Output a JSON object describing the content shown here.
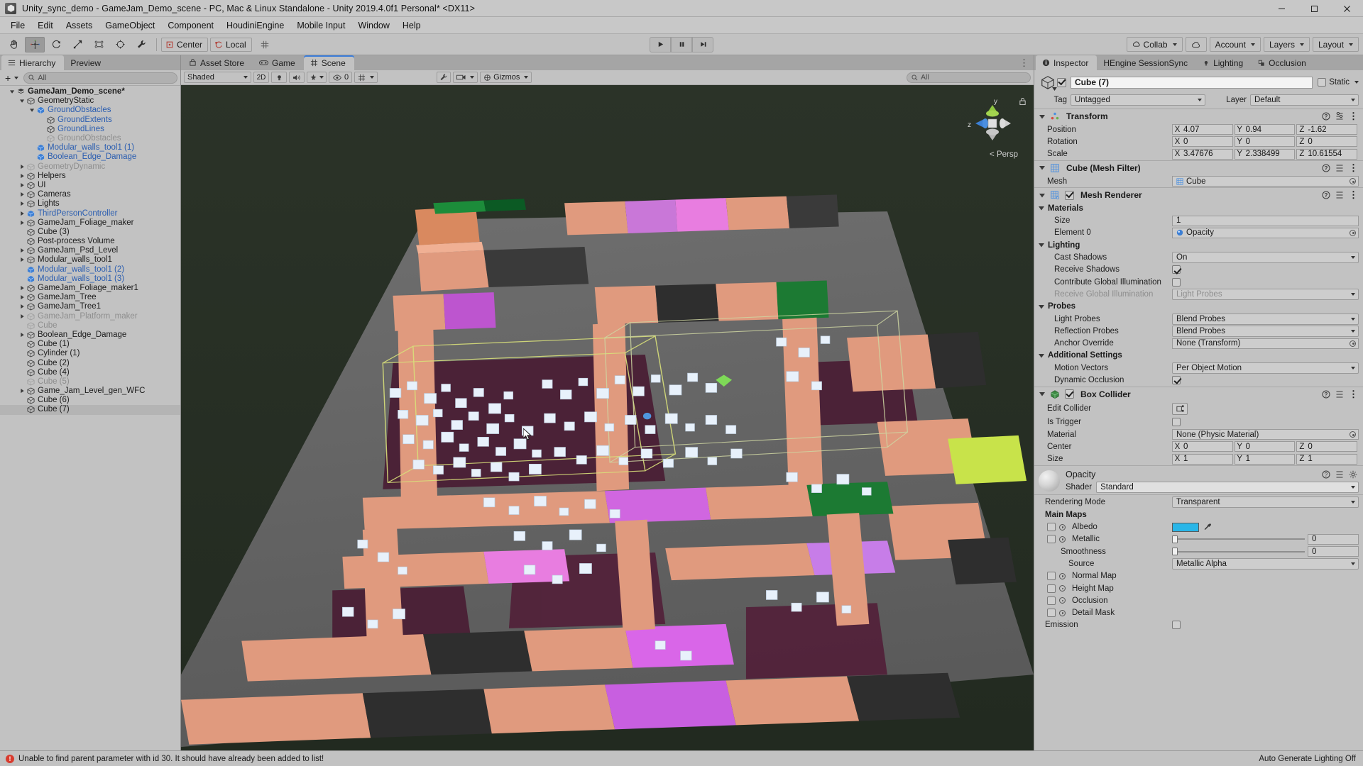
{
  "window": {
    "title": "Unity_sync_demo - GameJam_Demo_scene - PC, Mac & Linux Standalone - Unity 2019.4.0f1 Personal* <DX11>",
    "minimize": "—",
    "maximize": "❐",
    "close": "✕"
  },
  "menubar": {
    "items": [
      "File",
      "Edit",
      "Assets",
      "GameObject",
      "Component",
      "HoudiniEngine",
      "Mobile Input",
      "Window",
      "Help"
    ]
  },
  "toolbar": {
    "tools": [
      "hand-tool",
      "move-tool",
      "rotate-tool",
      "scale-tool",
      "rect-tool",
      "transform-tool",
      "custom-tool"
    ],
    "pivot_mode": "Center",
    "pivot_rotation": "Local",
    "grid_snap": "grid-snap-icon",
    "play": "play-button",
    "pause": "pause-button",
    "step": "step-button",
    "collab": "Collab",
    "cloud": "cloud-icon",
    "account": "Account",
    "layers": "Layers",
    "layout": "Layout"
  },
  "hierarchy": {
    "tabs": [
      {
        "label": "Hierarchy",
        "icon": "hierarchy-icon",
        "active": true
      },
      {
        "label": "Preview",
        "icon": "",
        "active": false
      }
    ],
    "create_label": "+",
    "search_placeholder": "All",
    "items": [
      {
        "label": "GameJam_Demo_scene*",
        "depth": 0,
        "tri": "down",
        "icon": "scene",
        "style": "bold",
        "selected": false
      },
      {
        "label": "GeometryStatic",
        "depth": 1,
        "tri": "down",
        "icon": "go",
        "style": "normal",
        "selected": false
      },
      {
        "label": "GroundObstacles",
        "depth": 2,
        "tri": "down",
        "icon": "prefab",
        "style": "prefab",
        "selected": false
      },
      {
        "label": "GroundExtents",
        "depth": 3,
        "tri": "none",
        "icon": "go",
        "style": "prefab",
        "selected": false
      },
      {
        "label": "GroundLines",
        "depth": 3,
        "tri": "none",
        "icon": "go",
        "style": "prefab",
        "selected": false
      },
      {
        "label": "GroundObstacles",
        "depth": 3,
        "tri": "none",
        "icon": "go-dim",
        "style": "dim",
        "selected": false
      },
      {
        "label": "Modular_walls_tool1 (1)",
        "depth": 2,
        "tri": "none",
        "icon": "prefab",
        "style": "prefab",
        "selected": false
      },
      {
        "label": "Boolean_Edge_Damage",
        "depth": 2,
        "tri": "none",
        "icon": "prefab",
        "style": "prefab",
        "selected": false
      },
      {
        "label": "GeometryDynamic",
        "depth": 1,
        "tri": "right",
        "icon": "go-dim",
        "style": "dim",
        "selected": false
      },
      {
        "label": "Helpers",
        "depth": 1,
        "tri": "right",
        "icon": "go",
        "style": "normal",
        "selected": false
      },
      {
        "label": "UI",
        "depth": 1,
        "tri": "right",
        "icon": "go",
        "style": "normal",
        "selected": false
      },
      {
        "label": "Cameras",
        "depth": 1,
        "tri": "right",
        "icon": "go",
        "style": "normal",
        "selected": false
      },
      {
        "label": "Lights",
        "depth": 1,
        "tri": "right",
        "icon": "go",
        "style": "normal",
        "selected": false
      },
      {
        "label": "ThirdPersonController",
        "depth": 1,
        "tri": "right",
        "icon": "prefab",
        "style": "prefab",
        "selected": false
      },
      {
        "label": "GameJam_Foliage_maker",
        "depth": 1,
        "tri": "right",
        "icon": "go",
        "style": "normal",
        "selected": false
      },
      {
        "label": "Cube (3)",
        "depth": 1,
        "tri": "none",
        "icon": "go",
        "style": "normal",
        "selected": false
      },
      {
        "label": "Post-process Volume",
        "depth": 1,
        "tri": "none",
        "icon": "go",
        "style": "normal",
        "selected": false
      },
      {
        "label": "GameJam_Psd_Level",
        "depth": 1,
        "tri": "right",
        "icon": "go",
        "style": "normal",
        "selected": false
      },
      {
        "label": "Modular_walls_tool1",
        "depth": 1,
        "tri": "right",
        "icon": "go",
        "style": "normal",
        "selected": false
      },
      {
        "label": "Modular_walls_tool1 (2)",
        "depth": 1,
        "tri": "none",
        "icon": "prefab",
        "style": "prefab",
        "selected": false
      },
      {
        "label": "Modular_walls_tool1 (3)",
        "depth": 1,
        "tri": "none",
        "icon": "prefab",
        "style": "prefab",
        "selected": false
      },
      {
        "label": "GameJam_Foliage_maker1",
        "depth": 1,
        "tri": "right",
        "icon": "go",
        "style": "normal",
        "selected": false
      },
      {
        "label": "GameJam_Tree",
        "depth": 1,
        "tri": "right",
        "icon": "go",
        "style": "normal",
        "selected": false
      },
      {
        "label": "GameJam_Tree1",
        "depth": 1,
        "tri": "right",
        "icon": "go",
        "style": "normal",
        "selected": false
      },
      {
        "label": "GameJam_Platform_maker",
        "depth": 1,
        "tri": "right",
        "icon": "go-dim",
        "style": "dim",
        "selected": false
      },
      {
        "label": "Cube",
        "depth": 1,
        "tri": "none",
        "icon": "go-dim",
        "style": "dim",
        "selected": false
      },
      {
        "label": "Boolean_Edge_Damage",
        "depth": 1,
        "tri": "right",
        "icon": "go",
        "style": "normal",
        "selected": false
      },
      {
        "label": "Cube (1)",
        "depth": 1,
        "tri": "none",
        "icon": "go",
        "style": "normal",
        "selected": false
      },
      {
        "label": "Cylinder (1)",
        "depth": 1,
        "tri": "none",
        "icon": "go",
        "style": "normal",
        "selected": false
      },
      {
        "label": "Cube (2)",
        "depth": 1,
        "tri": "none",
        "icon": "go",
        "style": "normal",
        "selected": false
      },
      {
        "label": "Cube (4)",
        "depth": 1,
        "tri": "none",
        "icon": "go",
        "style": "normal",
        "selected": false
      },
      {
        "label": "Cube (5)",
        "depth": 1,
        "tri": "none",
        "icon": "go-dim",
        "style": "dim",
        "selected": false
      },
      {
        "label": "Game_Jam_Level_gen_WFC",
        "depth": 1,
        "tri": "right",
        "icon": "go",
        "style": "normal",
        "selected": false
      },
      {
        "label": "Cube (6)",
        "depth": 1,
        "tri": "none",
        "icon": "go",
        "style": "normal",
        "selected": false
      },
      {
        "label": "Cube (7)",
        "depth": 1,
        "tri": "none",
        "icon": "go",
        "style": "normal",
        "selected": true
      }
    ]
  },
  "scene": {
    "tabs": [
      {
        "label": "Asset Store",
        "icon": "store-icon",
        "active": false
      },
      {
        "label": "Game",
        "icon": "game-icon",
        "active": false
      },
      {
        "label": "Scene",
        "icon": "scene-icon",
        "active": true
      }
    ],
    "draw_mode": "Shaded",
    "mode_2d": "2D",
    "lighting_toggle": "lighting-icon",
    "audio_toggle": "audio-icon",
    "fx_toggle": "fx-icon",
    "hidden_count": "0",
    "scene_vis": "scene-vis-icon",
    "gizmos": "Gizmos",
    "search_placeholder": "All",
    "gizmo_axes": {
      "y": "y",
      "z": "z"
    },
    "projection": "Persp"
  },
  "inspector": {
    "tabs": [
      {
        "label": "Inspector",
        "icon": "info-icon",
        "active": true
      },
      {
        "label": "HEngine SessionSync",
        "icon": "",
        "active": false
      },
      {
        "label": "Lighting",
        "icon": "lighting-icon",
        "active": false
      },
      {
        "label": "Occlusion",
        "icon": "occlusion-icon",
        "active": false
      }
    ],
    "object": {
      "enabled": true,
      "name": "Cube (7)",
      "static_label": "Static"
    },
    "tag_label": "Tag",
    "tag_value": "Untagged",
    "layer_label": "Layer",
    "layer_value": "Default",
    "transform": {
      "title": "Transform",
      "rows": [
        {
          "name": "Position",
          "x": "4.07",
          "y": "0.94",
          "z": "-1.62"
        },
        {
          "name": "Rotation",
          "x": "0",
          "y": "0",
          "z": "0"
        },
        {
          "name": "Scale",
          "x": "3.47676",
          "y": "2.338499",
          "z": "10.61554"
        }
      ]
    },
    "mesh_filter": {
      "title": "Cube (Mesh Filter)",
      "mesh_label": "Mesh",
      "mesh_value": "Cube"
    },
    "mesh_renderer": {
      "title": "Mesh Renderer",
      "enabled": true,
      "materials_label": "Materials",
      "size_label": "Size",
      "size_value": "1",
      "element0_label": "Element 0",
      "element0_value": "Opacity",
      "lighting_label": "Lighting",
      "cast_shadows_label": "Cast Shadows",
      "cast_shadows_value": "On",
      "receive_shadows_label": "Receive Shadows",
      "receive_shadows_checked": true,
      "contribute_gi_label": "Contribute Global Illumination",
      "contribute_gi_checked": false,
      "receive_gi_label": "Receive Global Illumination",
      "receive_gi_value": "Light Probes",
      "probes_label": "Probes",
      "light_probes_label": "Light Probes",
      "light_probes_value": "Blend Probes",
      "reflection_probes_label": "Reflection Probes",
      "reflection_probes_value": "Blend Probes",
      "anchor_override_label": "Anchor Override",
      "anchor_override_value": "None (Transform)",
      "additional_settings_label": "Additional Settings",
      "motion_vectors_label": "Motion Vectors",
      "motion_vectors_value": "Per Object Motion",
      "dynamic_occlusion_label": "Dynamic Occlusion",
      "dynamic_occlusion_checked": true
    },
    "box_collider": {
      "title": "Box Collider",
      "enabled": true,
      "edit_collider_label": "Edit Collider",
      "is_trigger_label": "Is Trigger",
      "is_trigger_checked": false,
      "material_label": "Material",
      "material_value": "None (Physic Material)",
      "center_label": "Center",
      "center": {
        "x": "0",
        "y": "0",
        "z": "0"
      },
      "size_label": "Size",
      "size": {
        "x": "1",
        "y": "1",
        "z": "1"
      }
    },
    "material": {
      "name": "Opacity",
      "shader_label": "Shader",
      "shader_value": "Standard",
      "rendering_mode_label": "Rendering Mode",
      "rendering_mode_value": "Transparent",
      "main_maps_label": "Main Maps",
      "albedo_label": "Albedo",
      "albedo_color": "#29b6e8",
      "metallic_label": "Metallic",
      "metallic_value": "0",
      "smoothness_label": "Smoothness",
      "smoothness_value": "0",
      "source_label": "Source",
      "source_value": "Metallic Alpha",
      "normal_map_label": "Normal Map",
      "height_map_label": "Height Map",
      "occlusion_label": "Occlusion",
      "detail_mask_label": "Detail Mask",
      "emission_label": "Emission",
      "emission_checked": false
    }
  },
  "statusbar": {
    "message": "Unable to find parent parameter with id 30. It should have already been added to list!",
    "right": "Auto Generate Lighting Off"
  }
}
